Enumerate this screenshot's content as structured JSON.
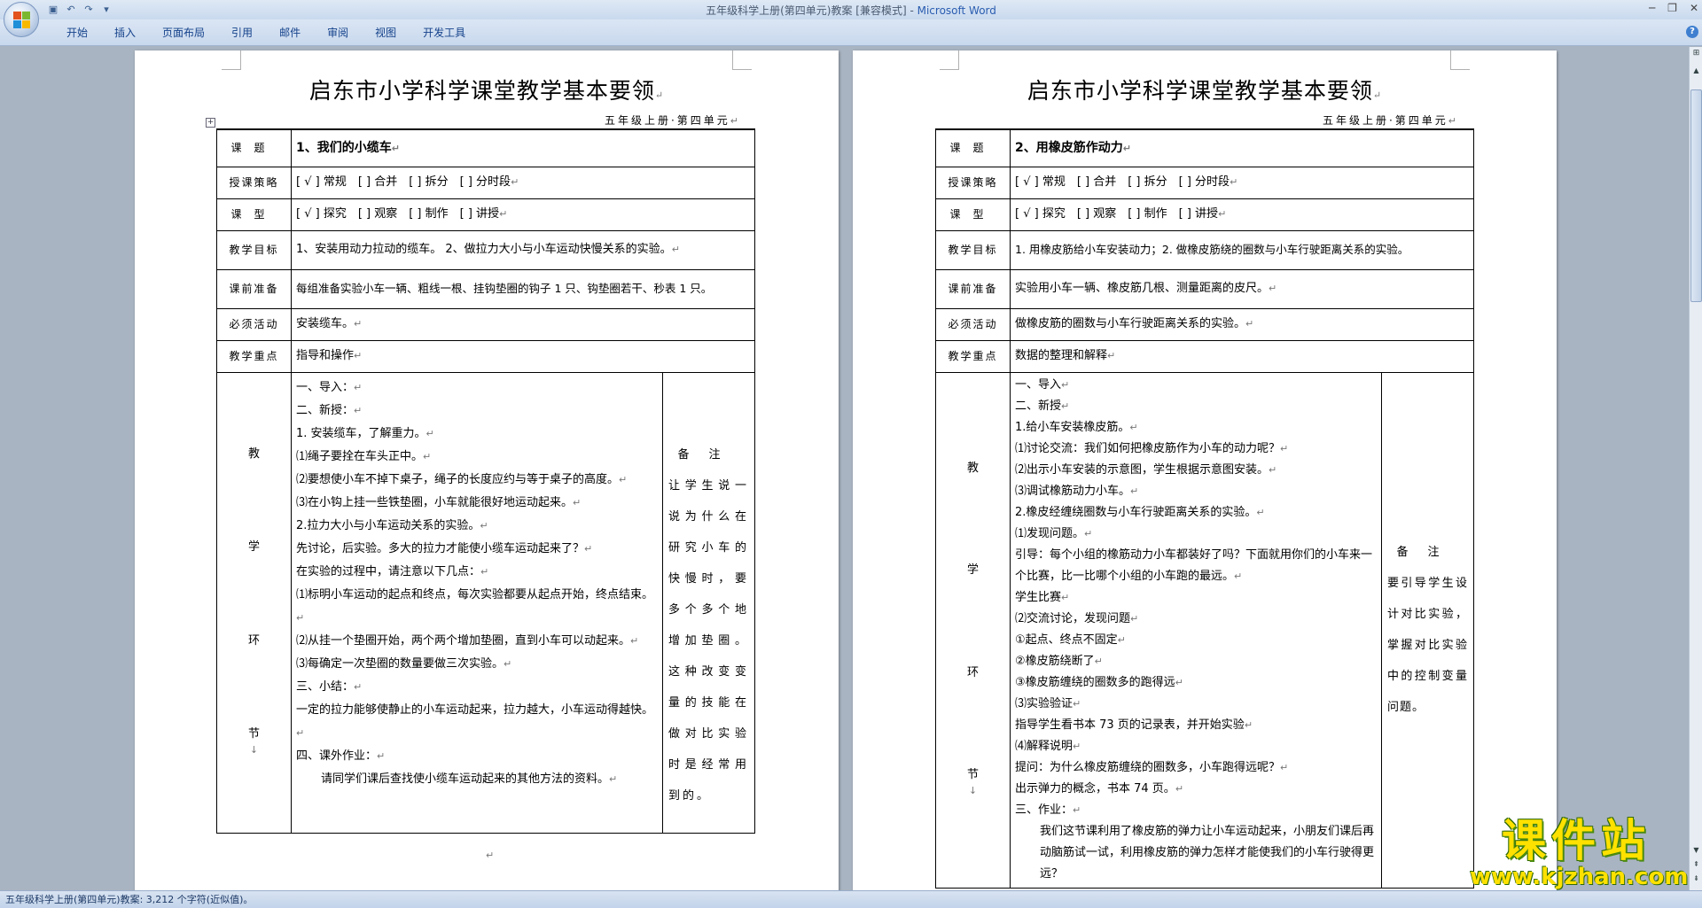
{
  "window": {
    "title": "五年级科学上册(第四单元)教案 [兼容模式] - ",
    "app_name": "Microsoft Word"
  },
  "ribbon": {
    "tabs": [
      "开始",
      "插入",
      "页面布局",
      "引用",
      "邮件",
      "审阅",
      "视图",
      "开发工具"
    ]
  },
  "status_bar": {
    "text": "五年级科学上册(第四单元)教案: 3,212 个字符(近似值)。"
  },
  "watermark": {
    "title": "课件站",
    "url": "www.kjzhan.com"
  },
  "marks": {
    "para": "↵",
    "small": "↓"
  },
  "pages": [
    {
      "doc_title": "启东市小学科学课堂教学基本要领",
      "subtitle": "五年级上册·第四单元",
      "labels": {
        "topic": "课题",
        "strategy": "授课策略",
        "type": "课型",
        "goal": "教学目标",
        "prep": "课前准备",
        "activity": "必须活动",
        "focus": "教学重点",
        "process_chars": [
          "教",
          "学",
          "环",
          "节"
        ]
      },
      "topic": "1、我们的小缆车",
      "strategy": "[ √ ] 常规　[ ] 合并　[ ] 拆分　[ ] 分时段",
      "type": "[ √ ] 探究　[ ] 观察　[ ] 制作　[ ] 讲授",
      "goal": "1、安装用动力拉动的缆车。 2、做拉力大小与小车运动快慢关系的实验。",
      "prep": "每组准备实验小车一辆、粗线一根、挂钩垫圈的钩子 1 只、钩垫圈若干、秒表 1 只。",
      "activity": "安装缆车。",
      "focus": "指导和操作",
      "process": [
        "一、导入：",
        "二、新授：",
        "1. 安装缆车，了解重力。",
        "⑴绳子要拴在车头正中。",
        "⑵要想使小车不掉下桌子，绳子的长度应约与等于桌子的高度。",
        "⑶在小钩上挂一些铁垫圈，小车就能很好地运动起来。",
        "2.拉力大小与小车运动关系的实验。",
        "先讨论，后实验。多大的拉力才能使小缆车运动起来了？",
        "在实验的过程中，请注意以下几点：",
        "⑴标明小车运动的起点和终点，每次实验都要从起点开始，终点结束。",
        "⑵从挂一个垫圈开始，两个两个增加垫圈，直到小车可以动起来。",
        "⑶每确定一次垫圈的数量要做三次实验。",
        "三、小结：",
        "一定的拉力能够使静止的小车运动起来，拉力越大，小车运动得越快。",
        "四、课外作业：",
        "请同学们课后查找使小缆车运动起来的其他方法的资料。"
      ],
      "notes_header": "备注",
      "notes": "让学生说一说为什么在研究小车的快慢时，要多个多个地增加垫圈。这种改变变量的技能在做对比实验时是经常用到的。"
    },
    {
      "doc_title": "启东市小学科学课堂教学基本要领",
      "subtitle": "五年级上册·第四单元",
      "labels": {
        "topic": "课题",
        "strategy": "授课策略",
        "type": "课型",
        "goal": "教学目标",
        "prep": "课前准备",
        "activity": "必须活动",
        "focus": "教学重点",
        "process_chars": [
          "教",
          "学",
          "环",
          "节"
        ]
      },
      "topic": "2、用橡皮筋作动力",
      "strategy": "[ √ ] 常规　[ ] 合并　[ ] 拆分　[ ] 分时段",
      "type": "[ √ ] 探究　[ ] 观察　[ ] 制作　[ ] 讲授",
      "goal": "1. 用橡皮筋给小车安装动力；2. 做橡皮筋绕的圈数与小车行驶距离关系的实验。",
      "prep": "实验用小车一辆、橡皮筋几根、测量距离的皮尺。",
      "activity": "做橡皮筋的圈数与小车行驶距离关系的实验。",
      "focus": "数据的整理和解释",
      "process": [
        "一、导入",
        "二、新授",
        "1.给小车安装橡皮筋。",
        "⑴讨论交流：我们如何把橡皮筋作为小车的动力呢？",
        "⑵出示小车安装的示意图，学生根据示意图安装。",
        "⑶调试橡筋动力小车。",
        "2.橡皮经缠绕圈数与小车行驶距离关系的实验。",
        "⑴发现问题。",
        "引导：每个小组的橡筋动力小车都装好了吗？下面就用你们的小车来一个比赛，比一比哪个小组的小车跑的最远。",
        "学生比赛",
        "⑵交流讨论，发现问题",
        "①起点、终点不固定",
        "②橡皮筋绕断了",
        "③橡皮筋缠绕的圈数多的跑得远",
        "⑶实验验证",
        "指导学生看书本 73 页的记录表，并开始实验",
        "⑷解释说明",
        "提问：为什么橡皮筋缠绕的圈数多，小车跑得远呢？",
        "出示弹力的概念，书本 74 页。",
        "三、作业：",
        "我们这节课利用了橡皮筋的弹力让小车运动起来，小朋友们课后再动脑筋试一试，利用橡皮筋的弹力怎样才能使我们的小车行驶得更远？"
      ],
      "notes_header": "备注",
      "notes": "要引导学生设计对比实验，掌握对比实验中的控制变量问题。"
    }
  ]
}
